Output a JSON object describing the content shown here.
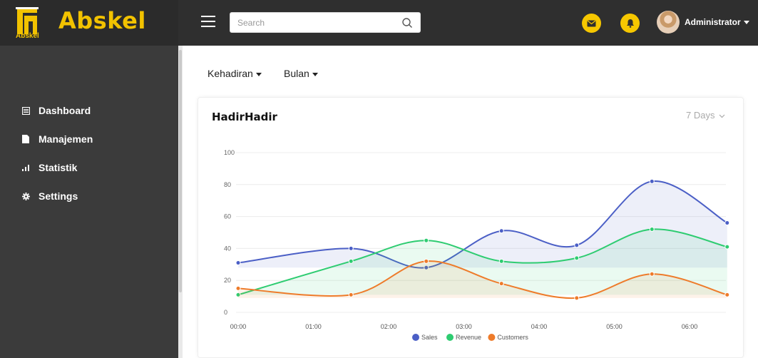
{
  "brand": {
    "logo_text": "Abskel",
    "title": "Abskel",
    "accent": "#f2c200"
  },
  "search": {
    "placeholder": "Search"
  },
  "user": {
    "name": "Administrator"
  },
  "icons": {
    "mail": "envelope-icon",
    "bell": "bell-icon",
    "search": "search-icon"
  },
  "sidebar": {
    "items": [
      {
        "label": "Dashboard",
        "icon": "dashboard-icon"
      },
      {
        "label": "Manajemen",
        "icon": "file-icon"
      },
      {
        "label": "Statistik",
        "icon": "bar-chart-icon"
      },
      {
        "label": "Settings",
        "icon": "gear-icon"
      }
    ]
  },
  "filters": {
    "first": "Kehadiran",
    "second": "Bulan"
  },
  "card": {
    "title": "HadirHadir",
    "range": "7 Days"
  },
  "chart_data": {
    "type": "area",
    "categories": [
      "00:00",
      "01:00",
      "02:00",
      "03:00",
      "04:00",
      "05:00",
      "06:00"
    ],
    "point_x": [
      0,
      1.5,
      2.5,
      3.5,
      4.5,
      5.5,
      6.5
    ],
    "ylim": [
      0,
      100
    ],
    "yticks": [
      0,
      20,
      40,
      60,
      80,
      100
    ],
    "grid": true,
    "legend_position": "bottom-center",
    "series": [
      {
        "name": "Sales",
        "color": "#4b5fc6",
        "values": [
          31,
          40,
          28,
          51,
          42,
          82,
          56
        ]
      },
      {
        "name": "Revenue",
        "color": "#2ecc71",
        "values": [
          11,
          32,
          45,
          32,
          34,
          52,
          41
        ]
      },
      {
        "name": "Customers",
        "color": "#ee7b2a",
        "values": [
          15,
          11,
          32,
          18,
          9,
          24,
          11
        ]
      }
    ]
  }
}
